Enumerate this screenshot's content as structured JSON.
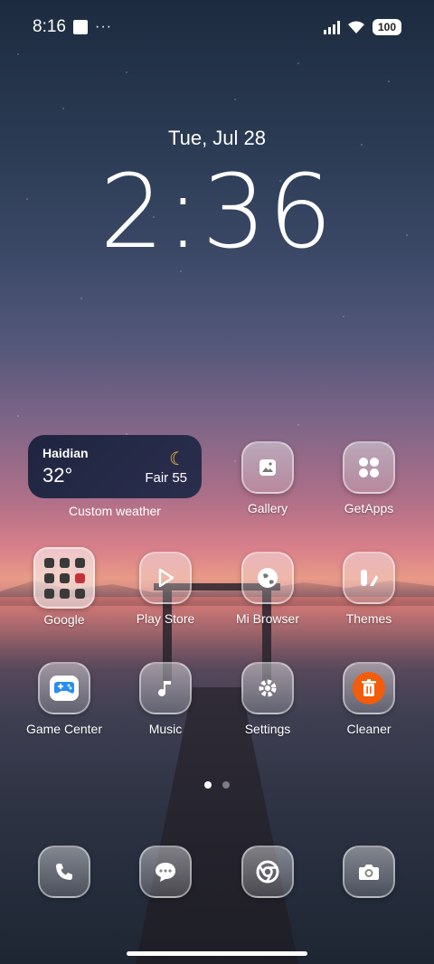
{
  "status_bar": {
    "time": "8:16",
    "dots": "···",
    "battery": "100"
  },
  "lock": {
    "date": "Tue, Jul 28",
    "time": "2:36"
  },
  "weather": {
    "city": "Haidian",
    "temp": "32°",
    "condition": "Fair 55",
    "label": "Custom weather"
  },
  "apps": [
    {
      "label": "Gallery",
      "icon": "gallery-icon"
    },
    {
      "label": "GetApps",
      "icon": "getapps-icon"
    },
    {
      "label": "Google",
      "icon": "folder-icon"
    },
    {
      "label": "Play Store",
      "icon": "play-store-icon"
    },
    {
      "label": "Mi Browser",
      "icon": "globe-icon"
    },
    {
      "label": "Themes",
      "icon": "themes-icon"
    },
    {
      "label": "Game Center",
      "icon": "gamepad-icon"
    },
    {
      "label": "Music",
      "icon": "music-note-icon"
    },
    {
      "label": "Settings",
      "icon": "gear-icon"
    },
    {
      "label": "Cleaner",
      "icon": "trash-icon"
    }
  ],
  "dock": [
    {
      "icon": "phone-icon"
    },
    {
      "icon": "messages-icon"
    },
    {
      "icon": "chrome-icon"
    },
    {
      "icon": "camera-icon"
    }
  ],
  "pager": {
    "pages": 2,
    "active": 1
  }
}
